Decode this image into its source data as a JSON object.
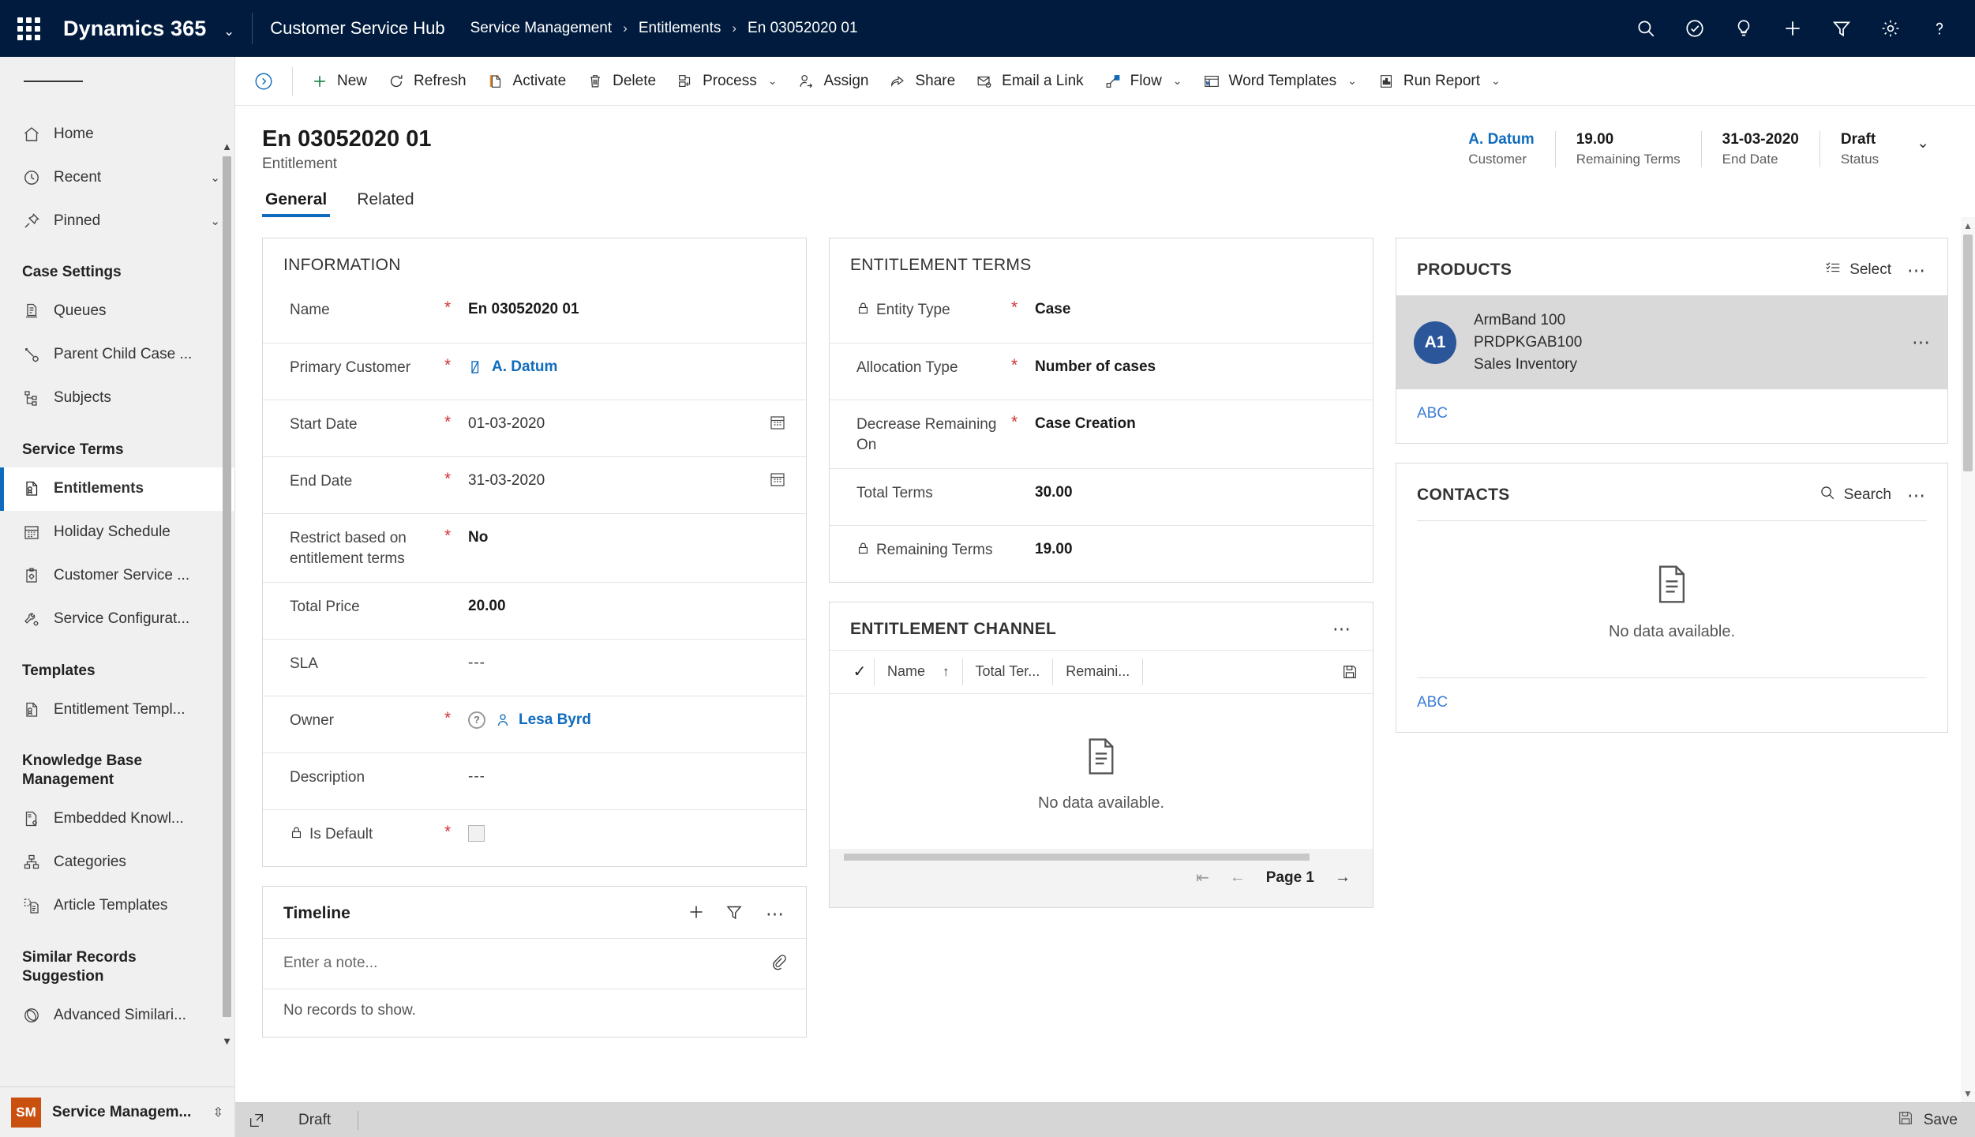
{
  "topbar": {
    "waffle_icon": "app-launcher-icon",
    "brand": "Dynamics 365",
    "brand_caret": "⌄",
    "app_title": "Customer Service Hub",
    "breadcrumb": [
      {
        "label": "Service Management"
      },
      {
        "label": "Entitlements"
      },
      {
        "label": "En 03052020 01"
      }
    ],
    "breadcrumb_separator": "›",
    "right_icons": [
      {
        "name": "search-icon"
      },
      {
        "name": "assistant-icon"
      },
      {
        "name": "lightbulb-icon"
      },
      {
        "name": "quick-create-icon"
      },
      {
        "name": "filter-icon"
      },
      {
        "name": "settings-gear-icon"
      },
      {
        "name": "help-icon"
      }
    ]
  },
  "sidebar": {
    "hamburger": "site-map-toggle",
    "items": [
      {
        "label": "Home",
        "icon": "home-icon",
        "type": "item"
      },
      {
        "label": "Recent",
        "icon": "clock-icon",
        "type": "item",
        "caret": "⌄"
      },
      {
        "label": "Pinned",
        "icon": "pin-icon",
        "type": "item",
        "caret": "⌄"
      },
      {
        "label": "Case Settings",
        "type": "group"
      },
      {
        "label": "Queues",
        "icon": "queue-icon",
        "type": "item"
      },
      {
        "label": "Parent Child Case ...",
        "icon": "parent-child-icon",
        "type": "item"
      },
      {
        "label": "Subjects",
        "icon": "subjects-icon",
        "type": "item"
      },
      {
        "label": "Service Terms",
        "type": "group"
      },
      {
        "label": "Entitlements",
        "icon": "entitlement-icon",
        "type": "item",
        "selected": true
      },
      {
        "label": "Holiday Schedule",
        "icon": "calendar-icon",
        "type": "item"
      },
      {
        "label": "Customer Service ...",
        "icon": "clipboard-gear-icon",
        "type": "item"
      },
      {
        "label": "Service Configurat...",
        "icon": "wrench-gear-icon",
        "type": "item"
      },
      {
        "label": "Templates",
        "type": "group"
      },
      {
        "label": "Entitlement Templ...",
        "icon": "entitlement-template-icon",
        "type": "item"
      },
      {
        "label": "Knowledge Base Management",
        "type": "group"
      },
      {
        "label": "Embedded Knowl...",
        "icon": "embedded-knowledge-icon",
        "type": "item"
      },
      {
        "label": "Categories",
        "icon": "categories-icon",
        "type": "item"
      },
      {
        "label": "Article Templates",
        "icon": "article-template-icon",
        "type": "item"
      },
      {
        "label": "Similar Records Suggestion",
        "type": "group"
      },
      {
        "label": "Advanced Similari...",
        "icon": "advanced-similarity-icon",
        "type": "item"
      }
    ],
    "footer": {
      "badge": "SM",
      "label": "Service Managem...",
      "caret": "⌃⌄"
    }
  },
  "commandbar": {
    "overflow_icon": "chevron-circle-right-icon",
    "buttons": [
      {
        "label": "New",
        "icon": "plus-icon"
      },
      {
        "label": "Refresh",
        "icon": "refresh-icon"
      },
      {
        "label": "Activate",
        "icon": "activate-doc-icon"
      },
      {
        "label": "Delete",
        "icon": "trash-icon"
      },
      {
        "label": "Process",
        "icon": "process-icon",
        "caret": "⌄"
      },
      {
        "label": "Assign",
        "icon": "assign-person-icon"
      },
      {
        "label": "Share",
        "icon": "share-icon"
      },
      {
        "label": "Email a Link",
        "icon": "email-link-icon"
      },
      {
        "label": "Flow",
        "icon": "flow-icon",
        "caret": "⌄"
      },
      {
        "label": "Word Templates",
        "icon": "word-template-icon",
        "caret": "⌄"
      },
      {
        "label": "Run Report",
        "icon": "run-report-icon",
        "caret": "⌄"
      }
    ]
  },
  "form_header": {
    "title": "En 03052020 01",
    "subtitle": "Entitlement",
    "fields": [
      {
        "value": "A. Datum",
        "label": "Customer",
        "link": true
      },
      {
        "value": "19.00",
        "label": "Remaining Terms"
      },
      {
        "value": "31-03-2020",
        "label": "End Date"
      },
      {
        "value": "Draft",
        "label": "Status"
      }
    ],
    "expand_caret": "⌄"
  },
  "tabs": [
    {
      "label": "General",
      "active": true
    },
    {
      "label": "Related",
      "active": false
    }
  ],
  "information": {
    "title": "INFORMATION",
    "rows": [
      {
        "label": "Name",
        "required": true,
        "value": "En 03052020 01",
        "style": "bold"
      },
      {
        "label": "Primary Customer",
        "required": true,
        "value": "A. Datum",
        "style": "link",
        "icon": "account-icon"
      },
      {
        "label": "Start Date",
        "required": true,
        "value": "01-03-2020",
        "style": "plain",
        "trailing_icon": "calendar-icon"
      },
      {
        "label": "End Date",
        "required": true,
        "value": "31-03-2020",
        "style": "plain",
        "trailing_icon": "calendar-icon"
      },
      {
        "label": "Restrict based on entitlement terms",
        "required": true,
        "value": "No",
        "style": "bold"
      },
      {
        "label": "Total Price",
        "required": false,
        "value": "20.00",
        "style": "bold"
      },
      {
        "label": "SLA",
        "required": false,
        "value": "---",
        "style": "dash"
      },
      {
        "label": "Owner",
        "required": true,
        "value": "Lesa Byrd",
        "style": "link",
        "icon": "user-icon",
        "lookup_indicator": true
      },
      {
        "label": "Description",
        "required": false,
        "value": "---",
        "style": "dash"
      },
      {
        "label": "Is Default",
        "required": true,
        "value": "",
        "style": "checkbox",
        "locked": true
      }
    ]
  },
  "entitlement_terms": {
    "title": "ENTITLEMENT TERMS",
    "rows": [
      {
        "label": "Entity Type",
        "required": true,
        "value": "Case",
        "style": "bold",
        "locked": true
      },
      {
        "label": "Allocation Type",
        "required": true,
        "value": "Number of cases",
        "style": "bold"
      },
      {
        "label": "Decrease Remaining On",
        "required": true,
        "value": "Case Creation",
        "style": "bold"
      },
      {
        "label": "Total Terms",
        "required": false,
        "value": "30.00",
        "style": "bold"
      },
      {
        "label": "Remaining Terms",
        "required": false,
        "value": "19.00",
        "style": "bold",
        "locked": true
      }
    ]
  },
  "entitlement_channel": {
    "title": "ENTITLEMENT CHANNEL",
    "more_icon": "overflow-icon",
    "columns": [
      {
        "label": "Name",
        "sort": "↑"
      },
      {
        "label": "Total Ter..."
      },
      {
        "label": "Remaini..."
      }
    ],
    "save_icon": "save-grid-icon",
    "empty_message": "No data available.",
    "pager": {
      "first_icon": "page-first-icon",
      "prev_icon": "page-prev-icon",
      "label": "Page 1",
      "next_icon": "page-next-icon"
    }
  },
  "products": {
    "title": "PRODUCTS",
    "select_label": "Select",
    "select_icon": "select-list-icon",
    "more_icon": "overflow-icon",
    "items": [
      {
        "initials": "A1",
        "name": "ArmBand 100",
        "code": "PRDPKGAB100",
        "category": "Sales Inventory",
        "row_more": "overflow-icon"
      }
    ],
    "footer_link": "ABC"
  },
  "contacts": {
    "title": "CONTACTS",
    "search_label": "Search",
    "search_icon": "search-icon",
    "more_icon": "overflow-icon",
    "empty_message": "No data available.",
    "footer_link": "ABC"
  },
  "timeline": {
    "title": "Timeline",
    "add_icon": "plus-icon",
    "filter_icon": "filter-icon",
    "more_icon": "overflow-icon",
    "note_placeholder": "Enter a note...",
    "attach_icon": "paperclip-icon",
    "empty_message": "No records to show."
  },
  "footer": {
    "popout_icon": "popout-icon",
    "status": "Draft",
    "save_label": "Save",
    "save_icon": "save-icon"
  },
  "colors": {
    "nav_bg": "#001b3d",
    "accent": "#0f6cbd",
    "required": "#d13438",
    "link": "#0f6cbd",
    "avatar": "#2b579a",
    "badge": "#ca5010"
  }
}
